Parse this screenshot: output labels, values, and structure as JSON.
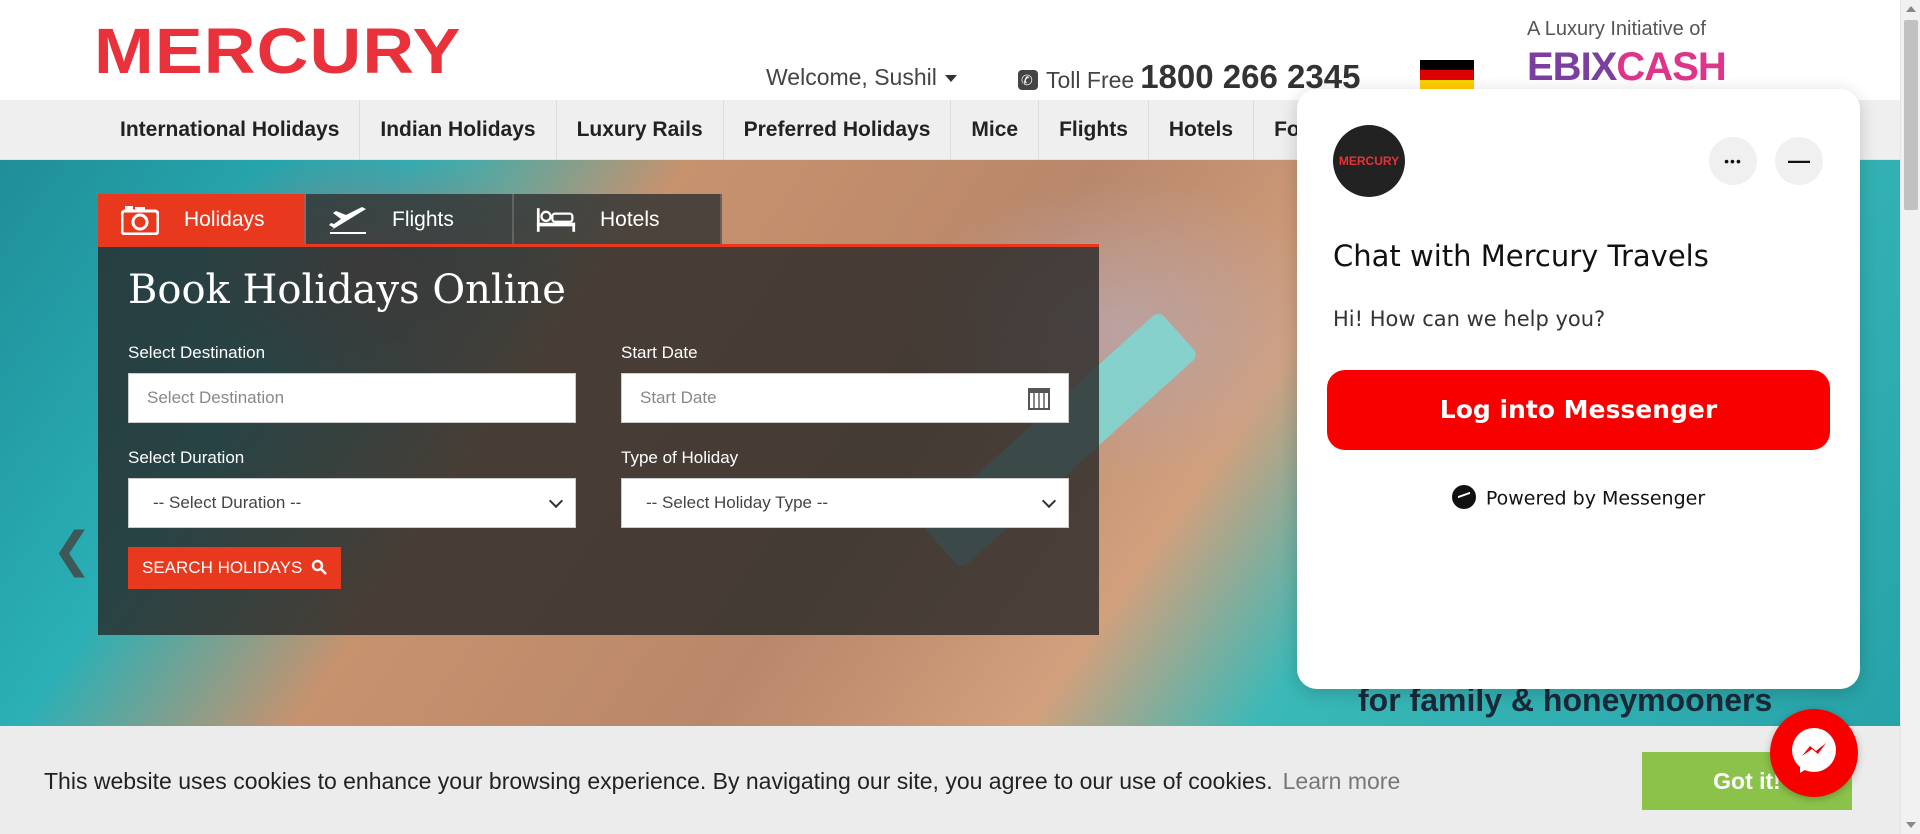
{
  "header": {
    "logo": "MERCURY",
    "welcome": "Welcome, Sushil",
    "toll_free_label": "Toll Free",
    "toll_free_number": "1800 266 2345",
    "flag": "germany-flag",
    "partner_tagline": "A Luxury Initiative of",
    "partner_brand_1": "EBIX",
    "partner_brand_2": "CASH"
  },
  "nav": {
    "items": [
      "International Holidays",
      "Indian Holidays",
      "Luxury Rails",
      "Preferred Holidays",
      "Mice",
      "Flights",
      "Hotels",
      "Fo"
    ]
  },
  "booking": {
    "tabs": [
      {
        "label": "Holidays",
        "icon": "camera-icon",
        "active": true
      },
      {
        "label": "Flights",
        "icon": "airplane-icon",
        "active": false
      },
      {
        "label": "Hotels",
        "icon": "bed-icon",
        "active": false
      }
    ],
    "title": "Book Holidays Online",
    "destination_label": "Select Destination",
    "destination_placeholder": "Select Destination",
    "start_date_label": "Start Date",
    "start_date_placeholder": "Start Date",
    "duration_label": "Select Duration",
    "duration_value": "-- Select Duration --",
    "holiday_type_label": "Type of Holiday",
    "holiday_type_value": "-- Select Holiday Type --",
    "search_label": "SEARCH HOLIDAYS"
  },
  "hero": {
    "caption": "for family & honeymooners"
  },
  "chat": {
    "avatar_text": "MERCURY",
    "title": "Chat with Mercury Travels",
    "subtitle": "Hi! How can we help you?",
    "login_label": "Log into Messenger",
    "powered_by": "Powered by Messenger",
    "more_icon": "•••",
    "minimize_icon": "—"
  },
  "cookie": {
    "text": "This website uses cookies to enhance your browsing experience. By navigating our site, you agree to our use of cookies.",
    "learn_more": "Learn more",
    "button": "Got it!"
  },
  "colors": {
    "brand_red": "#e8313a",
    "tab_active": "#e8391f",
    "messenger_red": "#f80000",
    "cookie_button": "#8bc34a"
  }
}
